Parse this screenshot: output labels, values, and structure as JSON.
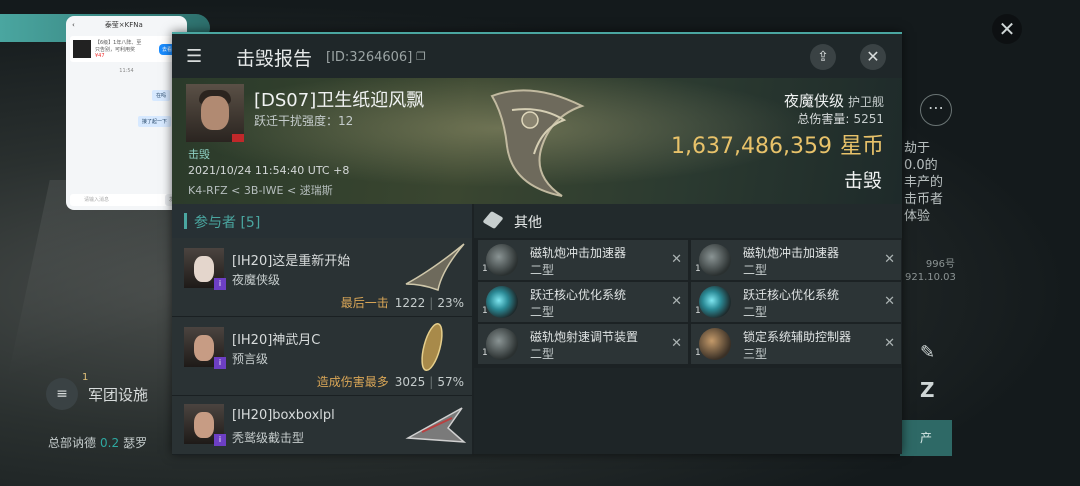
{
  "background": {
    "corp_label": "军团设施",
    "corp_count": "1",
    "hq_label": "总部讷德",
    "hq_value": "0.2",
    "hq_more": "瑟罗",
    "side_text": "劫于0.0的丰产的击币者体验",
    "side_small": "996号\n921.10.03",
    "side_button": "产",
    "close_icon": "✕",
    "more_icon": "⋯"
  },
  "phone": {
    "title": "泰莹×KFNa",
    "card_text": "【6级】1年八阵、至只告别，可利用奖",
    "card_price": "¥47",
    "card_button": "去看看",
    "time": "11:54",
    "msg1": "在吗",
    "msg2": "接了起一下",
    "input_placeholder": "请输入消息",
    "send": "发送"
  },
  "panel": {
    "title": "击毁报告",
    "kill_id": "[ID:3264606]",
    "accent": "#4aa6a0"
  },
  "victim": {
    "name": "[DS07]卫生纸迎风飘",
    "jam_strength": "跃迁干扰强度：12",
    "kill_label": "击毁",
    "time": "2021/10/24 11:54:40 UTC +8",
    "location": "K4-RFZ < 3B-IWE < 逑瑞斯",
    "ship_class": "夜魔侠级",
    "ship_type": "护卫舰",
    "damage_label": "总伤害量:",
    "damage_value": "5251",
    "isk_value": "1,637,486,359",
    "isk_unit": "星币",
    "status": "击毁"
  },
  "participants": {
    "header": "参与者 [5]",
    "items": [
      {
        "name": "[IH20]这是重新开始",
        "ship": "夜魔侠级",
        "tag": "最后一击",
        "damage": "1222",
        "percent": "23%"
      },
      {
        "name": "[IH20]神武月C",
        "ship": "预言级",
        "tag": "造成伤害最多",
        "damage": "3025",
        "percent": "57%"
      },
      {
        "name": "[IH20]boxboxlpl",
        "ship": "秃鹫级截击型",
        "tag": "",
        "damage": "",
        "percent": ""
      }
    ]
  },
  "others": {
    "header": "其他",
    "items": [
      {
        "name1": "磁轨炮冲击加速器",
        "name2": "二型",
        "qty": "1",
        "remove": "✕"
      },
      {
        "name1": "磁轨炮冲击加速器",
        "name2": "二型",
        "qty": "1",
        "remove": "✕"
      },
      {
        "name1": "跃迁核心优化系统",
        "name2": "二型",
        "qty": "1",
        "remove": "✕"
      },
      {
        "name1": "跃迁核心优化系统",
        "name2": "二型",
        "qty": "1",
        "remove": "✕"
      },
      {
        "name1": "磁轨炮射速调节装置",
        "name2": "二型",
        "qty": "1",
        "remove": "✕"
      },
      {
        "name1": "锁定系统辅助控制器",
        "name2": "三型",
        "qty": "1",
        "remove": "✕"
      }
    ]
  }
}
